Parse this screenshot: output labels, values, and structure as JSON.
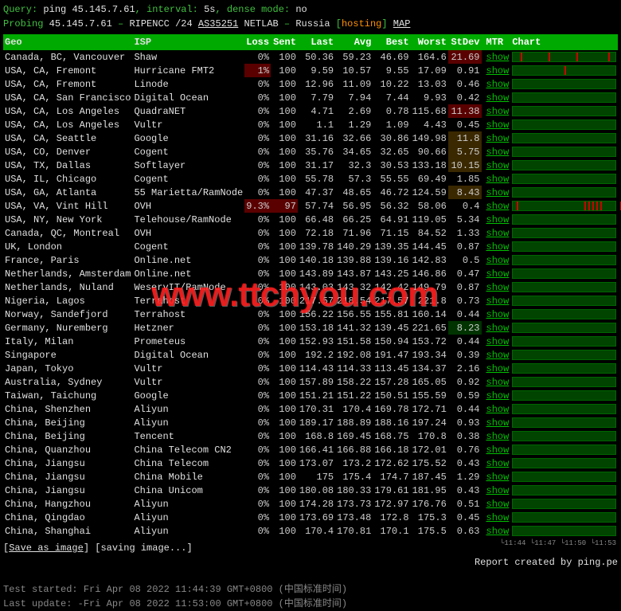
{
  "query": {
    "label": "Query:",
    "ping": "ping",
    "ip": "45.145.7.61",
    "interval_label": "interval:",
    "interval": "5s",
    "dense_label": "dense mode:",
    "dense": "no"
  },
  "probe": {
    "label": "Probing",
    "ip": "45.145.7.61",
    "registry": "RIPENCC",
    "prefix": "/24",
    "as": "AS35251",
    "org": "NETLAB",
    "country": "Russia",
    "hosting": "hosting",
    "map": "MAP"
  },
  "headers": {
    "geo": "Geo",
    "isp": "ISP",
    "loss": "Loss",
    "sent": "Sent",
    "last": "Last",
    "avg": "Avg",
    "best": "Best",
    "worst": "Worst",
    "stdev": "StDev",
    "mtr": "MTR",
    "chart": "Chart"
  },
  "mtr_label": "show",
  "rows": [
    {
      "geo": "Canada, BC, Vancouver",
      "isp": "Shaw",
      "loss": "0%",
      "sent": "100",
      "last": "50.36",
      "avg": "59.23",
      "best": "46.69",
      "worst": "164.6",
      "stdev": "21.69",
      "stdev_cls": "bg-bad",
      "ticks": [
        10,
        45,
        80,
        120
      ]
    },
    {
      "geo": "USA, CA, Fremont",
      "isp": "Hurricane FMT2",
      "loss": "1%",
      "loss_cls": "bg-bad",
      "sent": "100",
      "last": "9.59",
      "avg": "10.57",
      "best": "9.55",
      "worst": "17.09",
      "stdev": "0.91",
      "ticks": [
        65
      ]
    },
    {
      "geo": "USA, CA, Fremont",
      "isp": "Linode",
      "loss": "0%",
      "sent": "100",
      "last": "12.96",
      "avg": "11.09",
      "best": "10.22",
      "worst": "13.03",
      "stdev": "0.46"
    },
    {
      "geo": "USA, CA, San Francisco",
      "isp": "Digital Ocean",
      "loss": "0%",
      "sent": "100",
      "last": "7.79",
      "avg": "7.94",
      "best": "7.44",
      "worst": "9.93",
      "stdev": "0.42"
    },
    {
      "geo": "USA, CA, Los Angeles",
      "isp": "QuadraNET",
      "loss": "0%",
      "sent": "100",
      "last": "4.71",
      "avg": "2.69",
      "best": "0.78",
      "worst": "115.68",
      "stdev": "11.38",
      "stdev_cls": "bg-bad"
    },
    {
      "geo": "USA, CA, Los Angeles",
      "isp": "Vultr",
      "loss": "0%",
      "sent": "100",
      "last": "1.1",
      "avg": "1.29",
      "best": "1.09",
      "worst": "4.43",
      "stdev": "0.45"
    },
    {
      "geo": "USA, CA, Seattle",
      "isp": "Google",
      "loss": "0%",
      "sent": "100",
      "last": "31.16",
      "avg": "32.66",
      "best": "30.86",
      "worst": "149.98",
      "stdev": "11.8",
      "stdev_cls": "bg-warn"
    },
    {
      "geo": "USA, CO, Denver",
      "isp": "Cogent",
      "loss": "0%",
      "sent": "100",
      "last": "35.76",
      "avg": "34.65",
      "best": "32.65",
      "worst": "90.66",
      "stdev": "5.75",
      "stdev_cls": "bg-warn"
    },
    {
      "geo": "USA, TX, Dallas",
      "isp": "Softlayer",
      "loss": "0%",
      "sent": "100",
      "last": "31.17",
      "avg": "32.3",
      "best": "30.53",
      "worst": "133.18",
      "stdev": "10.15",
      "stdev_cls": "bg-warn"
    },
    {
      "geo": "USA, IL, Chicago",
      "isp": "Cogent",
      "loss": "0%",
      "sent": "100",
      "last": "55.78",
      "avg": "57.3",
      "best": "55.55",
      "worst": "69.49",
      "stdev": "1.85"
    },
    {
      "geo": "USA, GA, Atlanta",
      "isp": "55 Marietta/RamNode",
      "loss": "0%",
      "sent": "100",
      "last": "47.37",
      "avg": "48.65",
      "best": "46.72",
      "worst": "124.59",
      "stdev": "8.43",
      "stdev_cls": "bg-warn"
    },
    {
      "geo": "USA, VA, Vint Hill",
      "isp": "OVH",
      "loss": "9.3%",
      "loss_cls": "bg-bad",
      "sent": "97",
      "sent_cls": "bg-bad",
      "last": "57.74",
      "avg": "56.95",
      "best": "56.32",
      "worst": "58.06",
      "stdev": "0.4",
      "ticks": [
        5,
        90,
        95,
        100,
        105,
        110,
        135
      ]
    },
    {
      "geo": "USA, NY, New York",
      "isp": "Telehouse/RamNode",
      "loss": "0%",
      "sent": "100",
      "last": "66.48",
      "avg": "66.25",
      "best": "64.91",
      "worst": "119.05",
      "stdev": "5.34"
    },
    {
      "geo": "Canada, QC, Montreal",
      "isp": "OVH",
      "loss": "0%",
      "sent": "100",
      "last": "72.18",
      "avg": "71.96",
      "best": "71.15",
      "worst": "84.52",
      "stdev": "1.33"
    },
    {
      "geo": "UK, London",
      "isp": "Cogent",
      "loss": "0%",
      "sent": "100",
      "last": "139.78",
      "avg": "140.29",
      "best": "139.35",
      "worst": "144.45",
      "stdev": "0.87"
    },
    {
      "geo": "France, Paris",
      "isp": "Online.net",
      "loss": "0%",
      "sent": "100",
      "last": "140.18",
      "avg": "139.88",
      "best": "139.16",
      "worst": "142.83",
      "stdev": "0.5"
    },
    {
      "geo": "Netherlands, Amsterdam",
      "isp": "Online.net",
      "loss": "0%",
      "sent": "100",
      "last": "143.89",
      "avg": "143.87",
      "best": "143.25",
      "worst": "146.86",
      "stdev": "0.47"
    },
    {
      "geo": "Netherlands, Nuland",
      "isp": "WeservIT/RamNode",
      "loss": "0%",
      "sent": "100",
      "last": "143.03",
      "avg": "143.32",
      "best": "142.42",
      "worst": "149.79",
      "stdev": "0.87"
    },
    {
      "geo": "Nigeria, Lagos",
      "isp": "Terrahost",
      "loss": "0%",
      "sent": "100",
      "last": "217.57",
      "avg": "218.54",
      "best": "217.57",
      "worst": "221.8",
      "stdev": "0.73"
    },
    {
      "geo": "Norway, Sandefjord",
      "isp": "Terrahost",
      "loss": "0%",
      "sent": "100",
      "last": "156.22",
      "avg": "156.55",
      "best": "155.81",
      "worst": "160.14",
      "stdev": "0.44"
    },
    {
      "geo": "Germany, Nuremberg",
      "isp": "Hetzner",
      "loss": "0%",
      "sent": "100",
      "last": "153.18",
      "avg": "141.32",
      "best": "139.45",
      "worst": "221.65",
      "stdev": "8.23",
      "stdev_cls": "bg-good"
    },
    {
      "geo": "Italy, Milan",
      "isp": "Prometeus",
      "loss": "0%",
      "sent": "100",
      "last": "152.93",
      "avg": "151.58",
      "best": "150.94",
      "worst": "153.72",
      "stdev": "0.44"
    },
    {
      "geo": "Singapore",
      "isp": "Digital Ocean",
      "loss": "0%",
      "sent": "100",
      "last": "192.2",
      "avg": "192.08",
      "best": "191.47",
      "worst": "193.34",
      "stdev": "0.39"
    },
    {
      "geo": "Japan, Tokyo",
      "isp": "Vultr",
      "loss": "0%",
      "sent": "100",
      "last": "114.43",
      "avg": "114.33",
      "best": "113.45",
      "worst": "134.37",
      "stdev": "2.16"
    },
    {
      "geo": "Australia, Sydney",
      "isp": "Vultr",
      "loss": "0%",
      "sent": "100",
      "last": "157.89",
      "avg": "158.22",
      "best": "157.28",
      "worst": "165.05",
      "stdev": "0.92"
    },
    {
      "geo": "Taiwan, Taichung",
      "isp": "Google",
      "loss": "0%",
      "sent": "100",
      "last": "151.21",
      "avg": "151.22",
      "best": "150.51",
      "worst": "155.59",
      "stdev": "0.59"
    },
    {
      "geo": "China, Shenzhen",
      "isp": "Aliyun",
      "loss": "0%",
      "sent": "100",
      "last": "170.31",
      "avg": "170.4",
      "best": "169.78",
      "worst": "172.71",
      "stdev": "0.44"
    },
    {
      "geo": "China, Beijing",
      "isp": "Aliyun",
      "loss": "0%",
      "sent": "100",
      "last": "189.17",
      "avg": "188.89",
      "best": "188.16",
      "worst": "197.24",
      "stdev": "0.93"
    },
    {
      "geo": "China, Beijing",
      "isp": "Tencent",
      "loss": "0%",
      "sent": "100",
      "last": "168.8",
      "avg": "169.45",
      "best": "168.75",
      "worst": "170.8",
      "stdev": "0.38"
    },
    {
      "geo": "China, Quanzhou",
      "isp": "China Telecom CN2",
      "loss": "0%",
      "sent": "100",
      "last": "166.41",
      "avg": "166.88",
      "best": "166.18",
      "worst": "172.01",
      "stdev": "0.76"
    },
    {
      "geo": "China, Jiangsu",
      "isp": "China Telecom",
      "loss": "0%",
      "sent": "100",
      "last": "173.07",
      "avg": "173.2",
      "best": "172.62",
      "worst": "175.52",
      "stdev": "0.43"
    },
    {
      "geo": "China, Jiangsu",
      "isp": "China Mobile",
      "loss": "0%",
      "sent": "100",
      "last": "175",
      "avg": "175.4",
      "best": "174.7",
      "worst": "187.45",
      "stdev": "1.29"
    },
    {
      "geo": "China, Jiangsu",
      "isp": "China Unicom",
      "loss": "0%",
      "sent": "100",
      "last": "180.08",
      "avg": "180.33",
      "best": "179.61",
      "worst": "181.95",
      "stdev": "0.43"
    },
    {
      "geo": "China, Hangzhou",
      "isp": "Aliyun",
      "loss": "0%",
      "sent": "100",
      "last": "174.28",
      "avg": "173.73",
      "best": "172.97",
      "worst": "176.76",
      "stdev": "0.51"
    },
    {
      "geo": "China, Qingdao",
      "isp": "Aliyun",
      "loss": "0%",
      "sent": "100",
      "last": "173.69",
      "avg": "173.48",
      "best": "172.8",
      "worst": "175.3",
      "stdev": "0.45"
    },
    {
      "geo": "China, Shanghai",
      "isp": "Aliyun",
      "loss": "0%",
      "sent": "100",
      "last": "170.4",
      "avg": "170.81",
      "best": "170.1",
      "worst": "175.5",
      "stdev": "0.63"
    }
  ],
  "axis_ticks": [
    "11:44",
    "11:47",
    "11:50",
    "11:53"
  ],
  "footer": {
    "save": "Save as image",
    "saving": "saving image...",
    "report": "Report created by ping.pe",
    "started_label": "Test started:",
    "started": "Fri Apr 08 2022 11:44:39 GMT+0800 (中国标准时间)",
    "update_label": "Last update:",
    "update": "Fri Apr 08 2022 11:53:00 GMT+0800 (中国标准时间)"
  },
  "watermark": "www.ttchyou.com"
}
